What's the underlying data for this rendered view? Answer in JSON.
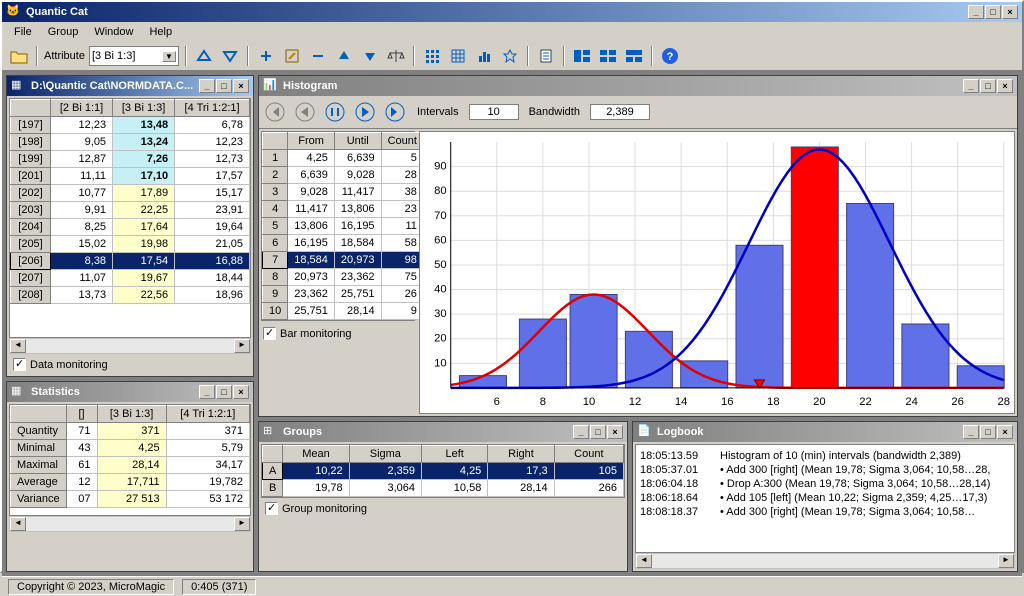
{
  "app": {
    "title": "Quantic Cat",
    "menu": [
      "File",
      "Group",
      "Window",
      "Help"
    ],
    "attr_label": "Attribute",
    "attr_value": "[3 Bi 1:3]",
    "copyright": "Copyright © 2023, MicroMagic",
    "status": "0:405 (371)"
  },
  "data_panel": {
    "title": "D:\\Quantic Cat\\NORMDATA.C...",
    "cols": [
      "[2 Bi 1:1]",
      "[3 Bi 1:3]",
      "[4 Tri 1:2:1]"
    ],
    "rows": [
      {
        "h": "[197]",
        "c": [
          "12,23",
          "13,48",
          "6,78"
        ],
        "hl": [
          0,
          1,
          0
        ]
      },
      {
        "h": "[198]",
        "c": [
          "9,05",
          "13,24",
          "12,23"
        ],
        "hl": [
          0,
          1,
          0
        ]
      },
      {
        "h": "[199]",
        "c": [
          "12,87",
          "7,26",
          "12,73"
        ],
        "hl": [
          0,
          1,
          0
        ]
      },
      {
        "h": "[201]",
        "c": [
          "11,11",
          "17,10",
          "17,57"
        ],
        "hl": [
          0,
          1,
          0
        ]
      },
      {
        "h": "[202]",
        "c": [
          "10,77",
          "17,89",
          "15,17"
        ],
        "hl": [
          0,
          2,
          0
        ]
      },
      {
        "h": "[203]",
        "c": [
          "9,91",
          "22,25",
          "23,91"
        ],
        "hl": [
          0,
          2,
          0
        ]
      },
      {
        "h": "[204]",
        "c": [
          "8,25",
          "17,64",
          "19,64"
        ],
        "hl": [
          0,
          2,
          0
        ]
      },
      {
        "h": "[205]",
        "c": [
          "15,02",
          "19,98",
          "21,05"
        ],
        "hl": [
          0,
          2,
          0
        ]
      },
      {
        "h": "[206]",
        "c": [
          "8,38",
          "17,54",
          "16,88"
        ],
        "hl": [
          0,
          2,
          0
        ],
        "sel": true
      },
      {
        "h": "[207]",
        "c": [
          "11,07",
          "19,67",
          "18,44"
        ],
        "hl": [
          0,
          2,
          0
        ]
      },
      {
        "h": "[208]",
        "c": [
          "13,73",
          "22,56",
          "18,96"
        ],
        "hl": [
          0,
          2,
          0
        ]
      }
    ],
    "monitor": "Data monitoring"
  },
  "stats_panel": {
    "title": "Statistics",
    "cols": [
      "[]",
      "[3 Bi 1:3]",
      "[4 Tri 1:2:1]"
    ],
    "rows": [
      {
        "h": "Quantity",
        "c": [
          "71",
          "371",
          "371"
        ]
      },
      {
        "h": "Minimal",
        "c": [
          "43",
          "4,25",
          "5,79"
        ]
      },
      {
        "h": "Maximal",
        "c": [
          "61",
          "28,14",
          "34,17"
        ]
      },
      {
        "h": "Average",
        "c": [
          "12",
          "17,711",
          "19,782"
        ]
      },
      {
        "h": "Variance",
        "c": [
          "07",
          "27 513",
          "53 172"
        ]
      }
    ]
  },
  "hist_panel": {
    "title": "Histogram",
    "intervals_label": "Intervals",
    "intervals": "10",
    "bandwidth_label": "Bandwidth",
    "bandwidth": "2,389",
    "table_cols": [
      "From",
      "Until",
      "Count"
    ],
    "intervals_data": [
      [
        "4,25",
        "6,639",
        "5"
      ],
      [
        "6,639",
        "9,028",
        "28"
      ],
      [
        "9,028",
        "11,417",
        "38"
      ],
      [
        "11,417",
        "13,806",
        "23"
      ],
      [
        "13,806",
        "16,195",
        "11"
      ],
      [
        "16,195",
        "18,584",
        "58"
      ],
      [
        "18,584",
        "20,973",
        "98"
      ],
      [
        "20,973",
        "23,362",
        "75"
      ],
      [
        "23,362",
        "25,751",
        "26"
      ],
      [
        "25,751",
        "28,14",
        "9"
      ]
    ],
    "sel_idx": 6,
    "bar_monitor": "Bar monitoring"
  },
  "chart_data": {
    "type": "bar",
    "categories": [
      5.4,
      8,
      10.2,
      12.6,
      15,
      17.4,
      19.8,
      22.2,
      24.6,
      27
    ],
    "values": [
      5,
      28,
      38,
      23,
      11,
      58,
      98,
      75,
      26,
      9
    ],
    "highlight_idx": 6,
    "ylim": [
      0,
      100
    ],
    "xlim": [
      4,
      28
    ],
    "xticks": [
      6,
      8,
      10,
      12,
      14,
      16,
      18,
      20,
      22,
      24,
      26,
      28
    ],
    "yticks": [
      10,
      20,
      30,
      40,
      50,
      60,
      70,
      80,
      90
    ],
    "curves": [
      {
        "name": "red",
        "color": "#e00000",
        "mean": 10.2,
        "sigma": 2.36,
        "scale": 38
      },
      {
        "name": "blue",
        "color": "#0000c0",
        "mean": 20.0,
        "sigma": 3.06,
        "scale": 97
      }
    ],
    "marker_x": 17.4
  },
  "groups_panel": {
    "title": "Groups",
    "cols": [
      "Mean",
      "Sigma",
      "Left",
      "Right",
      "Count"
    ],
    "rows": [
      {
        "h": "A",
        "c": [
          "10,22",
          "2,359",
          "4,25",
          "17,3",
          "105"
        ],
        "sel": true
      },
      {
        "h": "B",
        "c": [
          "19,78",
          "3,064",
          "10,58",
          "28,14",
          "266"
        ]
      }
    ],
    "monitor": "Group monitoring"
  },
  "logbook": {
    "title": "Logbook",
    "entries": [
      {
        "t": "18:05:13.59",
        "m": "Histogram of 10 (min) intervals (bandwidth 2,389)"
      },
      {
        "t": "18:05:37.01",
        "m": "• Add 300 [right] (Mean 19,78; Sigma 3,064; 10,58…28,"
      },
      {
        "t": "18:06:04.18",
        "m": "• Drop A:300 (Mean 19,78; Sigma 3,064; 10,58…28,14)"
      },
      {
        "t": "18:06:18.64",
        "m": "• Add 105 [left] (Mean 10,22; Sigma 2,359; 4,25…17,3)"
      },
      {
        "t": "18:08:18.37",
        "m": "• Add 300 [right] (Mean 19,78; Sigma 3,064; 10,58…"
      }
    ]
  }
}
